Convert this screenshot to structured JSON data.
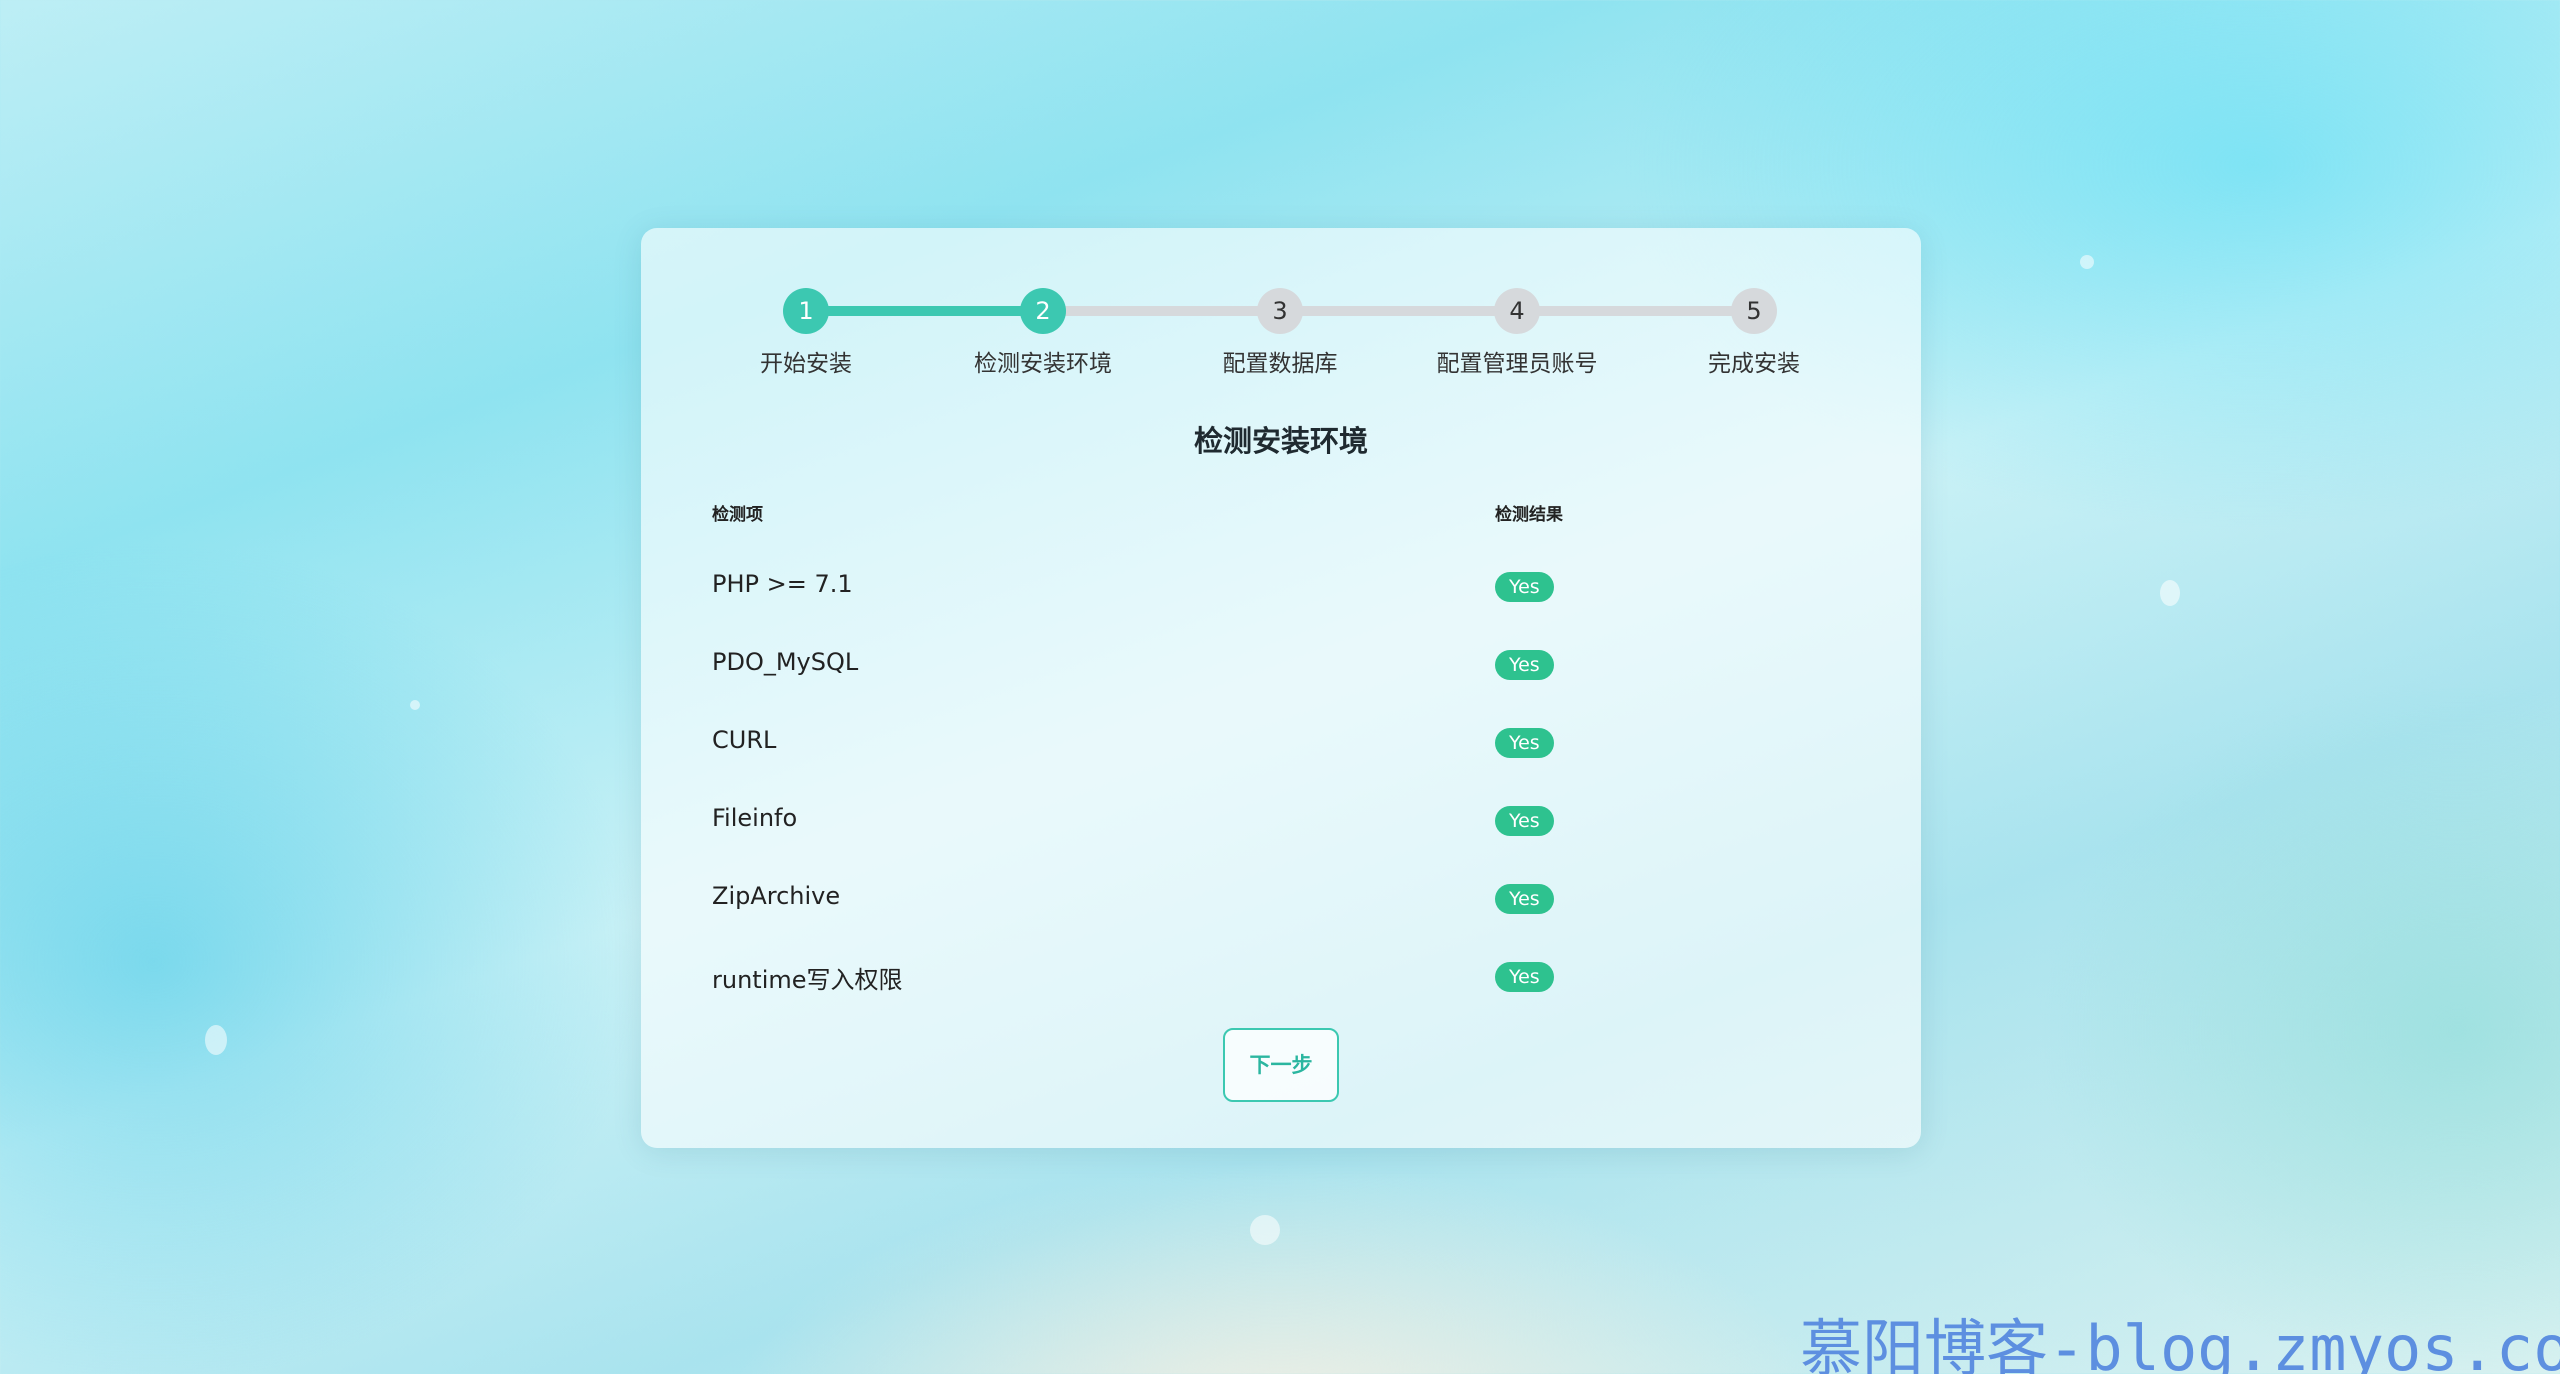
{
  "steps": [
    {
      "number": "1",
      "label": "开始安装"
    },
    {
      "number": "2",
      "label": "检测安装环境"
    },
    {
      "number": "3",
      "label": "配置数据库"
    },
    {
      "number": "4",
      "label": "配置管理员账号"
    },
    {
      "number": "5",
      "label": "完成安装"
    }
  ],
  "current_step": 2,
  "colors": {
    "accent": "#3cc8b1",
    "badge": "#2ec28f",
    "inactive": "#d6d9dc"
  },
  "page": {
    "title": "检测安装环境"
  },
  "table": {
    "headers": {
      "item": "检测项",
      "result": "检测结果"
    },
    "rows": [
      {
        "name": "PHP >= 7.1",
        "result": "Yes"
      },
      {
        "name": "PDO_MySQL",
        "result": "Yes"
      },
      {
        "name": "CURL",
        "result": "Yes"
      },
      {
        "name": "Fileinfo",
        "result": "Yes"
      },
      {
        "name": "ZipArchive",
        "result": "Yes"
      },
      {
        "name": "runtime写入权限",
        "result": "Yes"
      }
    ]
  },
  "actions": {
    "next_label": "下一步"
  },
  "watermark": "慕阳博客-blog.zmyos.com"
}
